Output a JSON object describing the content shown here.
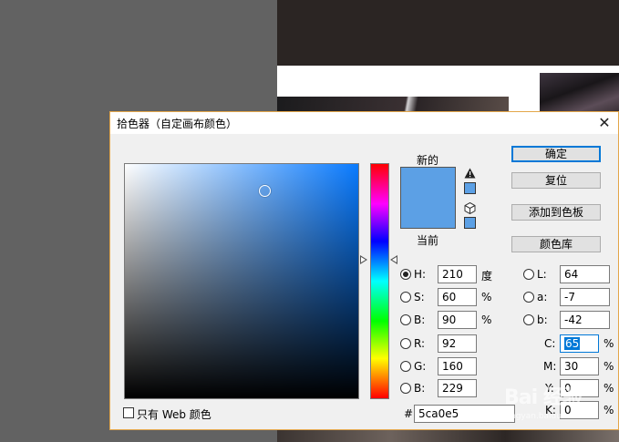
{
  "dialog": {
    "title": "拾色器（自定画布颜色）",
    "close_glyph": "✕"
  },
  "preview": {
    "new_label": "新的",
    "current_label": "当前",
    "new_color": "#5ca0e5",
    "current_color": "#5ca0e5",
    "gamut_warning_icon": "warning-triangle-icon",
    "web_safe_icon": "cube-icon"
  },
  "buttons": {
    "ok": "确定",
    "reset": "复位",
    "add_to_swatches": "添加到色板",
    "color_libraries": "颜色库"
  },
  "hsb": [
    {
      "label": "H:",
      "value": "210",
      "unit": "度",
      "checked": true
    },
    {
      "label": "S:",
      "value": "60",
      "unit": "%",
      "checked": false
    },
    {
      "label": "B:",
      "value": "90",
      "unit": "%",
      "checked": false
    }
  ],
  "rgb": [
    {
      "label": "R:",
      "value": "92"
    },
    {
      "label": "G:",
      "value": "160"
    },
    {
      "label": "B:",
      "value": "229"
    }
  ],
  "lab": [
    {
      "label": "L:",
      "value": "64"
    },
    {
      "label": "a:",
      "value": "-7"
    },
    {
      "label": "b:",
      "value": "-42"
    }
  ],
  "cmyk": [
    {
      "label": "C:",
      "value": "65",
      "unit": "%",
      "selected": true
    },
    {
      "label": "M:",
      "value": "30",
      "unit": "%"
    },
    {
      "label": "Y:",
      "value": "0",
      "unit": "%"
    },
    {
      "label": "K:",
      "value": "0",
      "unit": "%"
    }
  ],
  "hex": {
    "hash": "#",
    "value": "5ca0e5"
  },
  "web_only": {
    "label": "只有 Web 颜色",
    "checked": false
  },
  "watermark": {
    "text": "Bai 经验",
    "sub": "jingyan.baidu.com"
  }
}
